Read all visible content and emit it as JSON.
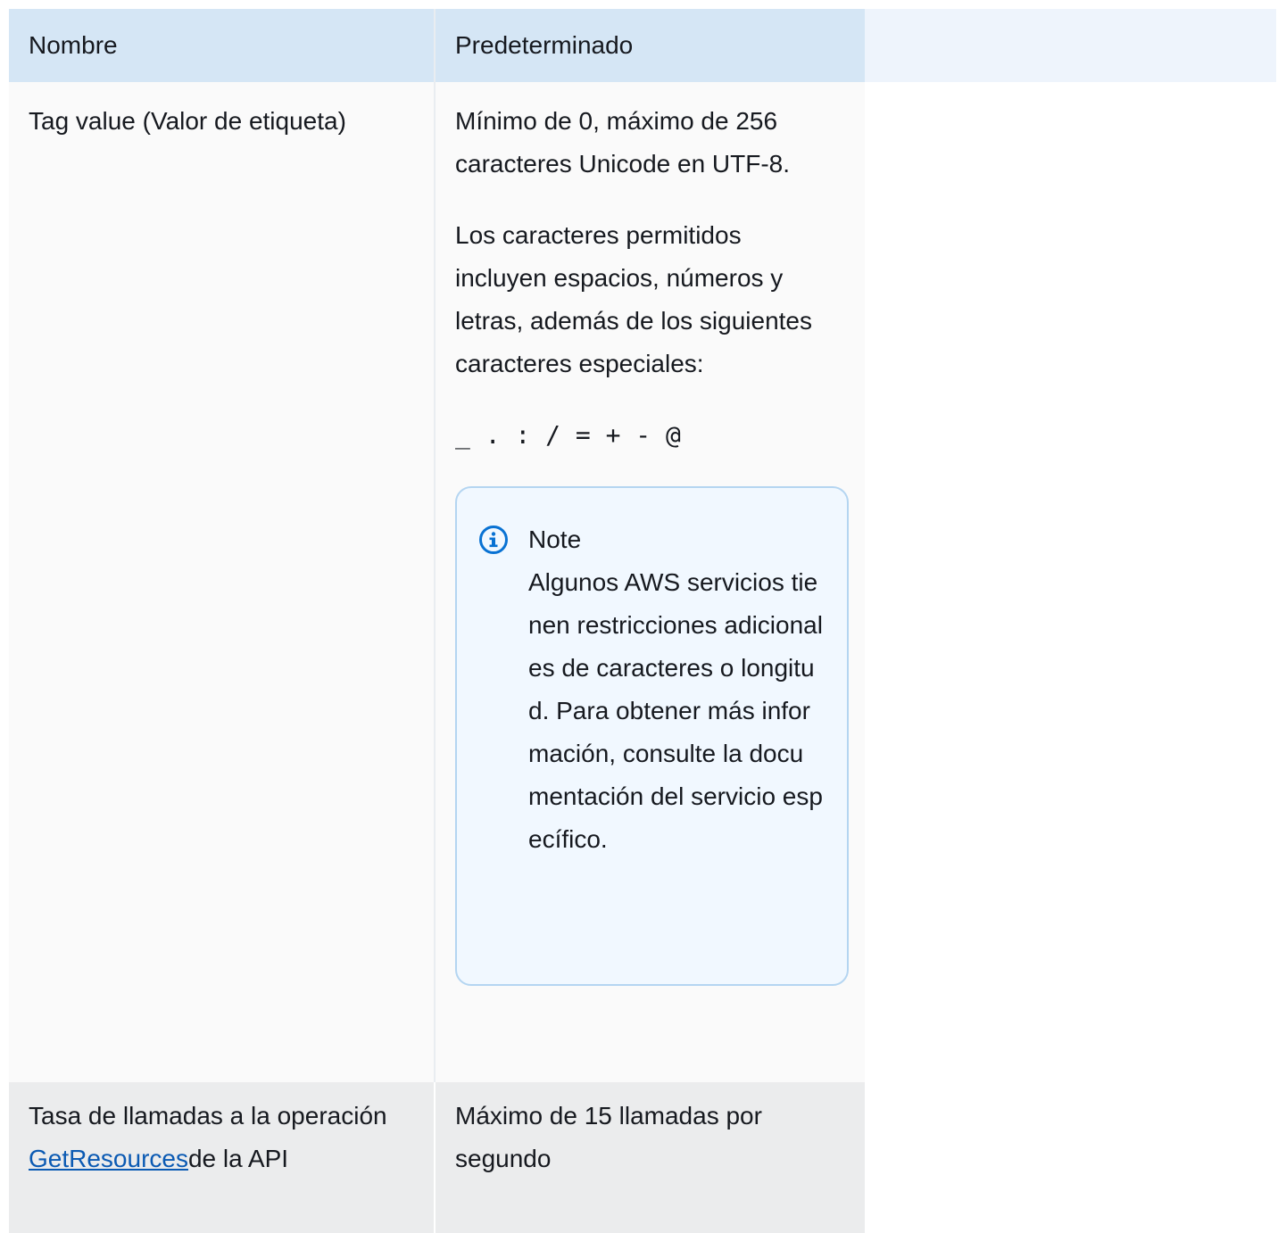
{
  "table": {
    "headers": {
      "name": "Nombre",
      "default": "Predeterminado",
      "extra": ""
    },
    "rows": [
      {
        "name": "Tag value (Valor de etiqueta)",
        "default_paragraphs": [
          "Mínimo de 0, máximo de 256 caracteres Unicode en UTF-8.",
          "Los caracteres permitidos incluyen espacios, números y letras, además de los siguientes caracteres especiales:"
        ],
        "special_chars": "_ . : / = + - @",
        "note": {
          "icon": "info-icon",
          "title": "Note",
          "body": "Algunos AWS servicios tienen restricciones adicionales de caracteres o longitud. Para obtener más información, consulte la documentación del servicio específico."
        }
      },
      {
        "name_prefix": "Tasa de llamadas a la operación ",
        "name_link": "GetResources",
        "name_suffix": "de la API",
        "default": "Máximo de 15 llamadas por segundo"
      }
    ]
  },
  "colors": {
    "header_bg": "#d5e6f5",
    "header_extra_bg": "#eef4fc",
    "row1_bg": "#fafafa",
    "row2_bg": "#ebeced",
    "note_border": "#b4d5f1",
    "note_bg": "#f1f8ff",
    "link": "#0b5ab3"
  }
}
